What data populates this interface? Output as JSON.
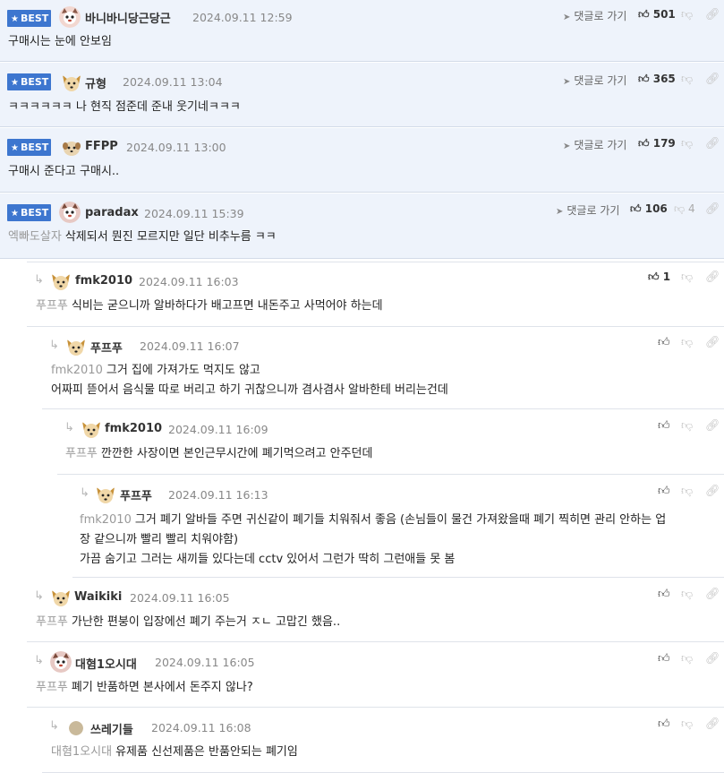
{
  "ui": {
    "best_label": "BEST",
    "goto_label": "댓글로 가기"
  },
  "colors": {
    "best_badge": "#3d76cf",
    "best_bg": "#eef3fb",
    "mention": "#999999"
  },
  "best_comments": [
    {
      "nick": "바니바니당근당근",
      "date": "2024.09.11 12:59",
      "likes": "501",
      "dislikes": "",
      "mention": "",
      "text": "구매시는 눈에 안보임"
    },
    {
      "nick": "규형",
      "date": "2024.09.11 13:04",
      "likes": "365",
      "dislikes": "",
      "mention": "",
      "text": "ㅋㅋㅋㅋㅋㅋ 나 현직 점준데 준내 웃기네ㅋㅋㅋ"
    },
    {
      "nick": "FFPP",
      "date": "2024.09.11 13:00",
      "likes": "179",
      "dislikes": "",
      "mention": "",
      "text": "구매시 준다고 구매시.."
    },
    {
      "nick": "paradax",
      "date": "2024.09.11 15:39",
      "likes": "106",
      "dislikes": "4",
      "mention": "엑빠도살자",
      "text": "삭제되서 뭔진 모르지만 일단 비추누름 ㅋㅋ"
    }
  ],
  "replies": [
    {
      "nick": "fmk2010",
      "date": "2024.09.11 16:03",
      "likes": "1",
      "mention": "푸프푸",
      "lines": [
        "식비는 굳으니까 알바하다가 배고프면 내돈주고 사먹어야 하는데"
      ]
    },
    {
      "nick": "푸프푸",
      "date": "2024.09.11 16:07",
      "likes": "",
      "mention": "fmk2010",
      "lines": [
        "그거 집에 가져가도 먹지도 않고",
        "어짜피 뜯어서 음식물 따로 버리고 하기 귀찮으니까 겸사겸사 알바한테 버리는건데"
      ]
    },
    {
      "nick": "fmk2010",
      "date": "2024.09.11 16:09",
      "likes": "",
      "mention": "푸프푸",
      "lines": [
        "깐깐한 사장이면 본인근무시간에 폐기먹으려고 안주던데"
      ]
    },
    {
      "nick": "푸프푸",
      "date": "2024.09.11 16:13",
      "likes": "",
      "mention": "fmk2010",
      "lines": [
        "그거 폐기 알바들 주면 귀신같이 폐기들 치워줘서 좋음 (손님들이 물건 가져왔을때 폐기 찍히면 관리 안하는 업",
        "장 같으니까 빨리 빨리 치워야함)",
        "가끔 숨기고 그러는 새끼들 있다는데 cctv 있어서 그런가 딱히 그런애들 못 봄"
      ]
    },
    {
      "nick": "Waikiki",
      "date": "2024.09.11 16:05",
      "likes": "",
      "mention": "푸프푸",
      "lines": [
        "가난한 편붕이 입장에선 폐기 주는거 ㅈㄴ 고맙긴 했음.."
      ]
    },
    {
      "nick": "대혐1오시대",
      "date": "2024.09.11 16:05",
      "likes": "",
      "mention": "푸프푸",
      "lines": [
        "폐기 반품하면 본사에서 돈주지 않나?"
      ]
    },
    {
      "nick": "쓰레기들",
      "date": "2024.09.11 16:08",
      "likes": "",
      "mention": "대혐1오시대",
      "lines": [
        "유제품 신선제품은 반품안되는 폐기임"
      ]
    }
  ]
}
